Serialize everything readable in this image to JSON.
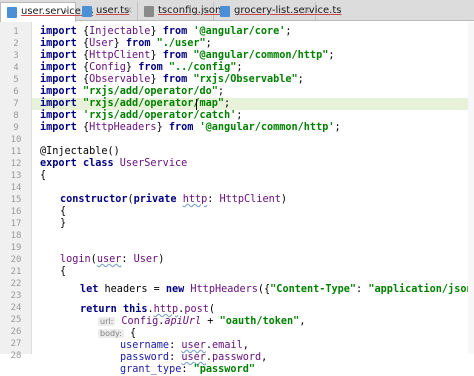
{
  "tabs": [
    {
      "label": "user.service.ts",
      "active": true,
      "icon": "typescript-file-icon"
    },
    {
      "label": "user.ts",
      "active": false,
      "icon": "typescript-file-icon"
    },
    {
      "label": "tsconfig.json",
      "active": false,
      "icon": "json-file-icon"
    },
    {
      "label": "grocery-list.service.ts",
      "active": false,
      "icon": "typescript-file-icon"
    }
  ],
  "close_glyph": "×",
  "line_numbers": [
    "1",
    "2",
    "3",
    "4",
    "5",
    "6",
    "7",
    "8",
    "9",
    "10",
    "11",
    "12",
    "13",
    "14",
    "15",
    "16",
    "17",
    "18",
    "19",
    "20",
    "21",
    "22",
    "23",
    "24",
    "25",
    "26",
    "27",
    "28"
  ],
  "highlighted_line": 7,
  "colors": {
    "keyword": "#000080",
    "string": "#008000",
    "identifier": "#660e7a",
    "line_highlight": "#e8f2d8"
  },
  "code": {
    "l1": {
      "import": "import",
      "open": " {",
      "name": "Injectable",
      "close": "} ",
      "from": "from",
      "str": " '@angular/core'",
      "end": ";"
    },
    "l2": {
      "import": "import",
      "open": " {",
      "name": "User",
      "close": "} ",
      "from": "from",
      "str": " \"./user\"",
      "end": ";"
    },
    "l3": {
      "import": "import",
      "open": " {",
      "name": "HttpClient",
      "close": "} ",
      "from": "from",
      "str": " \"@angular/common/http\"",
      "end": ";"
    },
    "l4": {
      "import": "import",
      "open": " {",
      "name": "Config",
      "close": "} ",
      "from": "from",
      "str": " \"../config\"",
      "end": ";"
    },
    "l5": {
      "import": "import",
      "open": " {",
      "name": "Observable",
      "close": "} ",
      "from": "from",
      "str": " \"rxjs/Observable\"",
      "end": ";"
    },
    "l6": {
      "import": "import",
      "str": " \"rxjs/add/operator/do\"",
      "end": ";"
    },
    "l7": {
      "import": "import",
      "str": " \"rxjs/add/operator/map\"",
      "end": ";"
    },
    "l8": {
      "import": "import",
      "str": " 'rxjs/add/operator/catch'",
      "end": ";"
    },
    "l9": {
      "import": "import",
      "open": " {",
      "name": "HttpHeaders",
      "close": "} ",
      "from": "from",
      "str": " '@angular/common/http'",
      "end": ";"
    },
    "l11": {
      "text": "@Injectable()"
    },
    "l12": {
      "export": "export",
      "class": " class ",
      "name": "UserService"
    },
    "l13": {
      "text": "{"
    },
    "l15": {
      "ctor": "constructor",
      "open": "(",
      "priv": "private",
      "sp": " ",
      "param": "http",
      "colon": ": ",
      "type": "HttpClient",
      "close": ")"
    },
    "l16": {
      "text": "{"
    },
    "l17": {
      "text": "}"
    },
    "l20": {
      "name": "login",
      "open": "(",
      "param": "user",
      "colon": ": ",
      "type": "User",
      "close": ")"
    },
    "l21": {
      "text": "{"
    },
    "l23": {
      "let": "let",
      "pre": " headers = ",
      "new": "new",
      "cls": " HttpHeaders",
      "open": "({",
      "k": "\"Content-Type\"",
      "colon": ": ",
      "v": "\"application/json\"",
      "end": "});"
    },
    "l25": {
      "ret": "return",
      "this": " this",
      "dot": ".",
      "http": "http",
      "dot2": ".",
      "post": "post",
      "open": "("
    },
    "l26": {
      "hint": "url:",
      "cfg": " Config",
      "dot": ".",
      "api": "apiUrl",
      "plus": " + ",
      "str": "\"oauth/token\"",
      "comma": ","
    },
    "l27": {
      "hint": "body:",
      "brace": " {"
    },
    "l28": {
      "key": "username",
      "colon": ": ",
      "obj": "user",
      "dot": ".",
      "prop": "email",
      "comma": ","
    },
    "l29": {
      "key": "password",
      "colon": ": ",
      "obj": "user",
      "dot": ".",
      "prop": "password",
      "comma": ","
    },
    "l30": {
      "key": "grant_type",
      "colon": ": ",
      "str": "\"password\""
    }
  }
}
